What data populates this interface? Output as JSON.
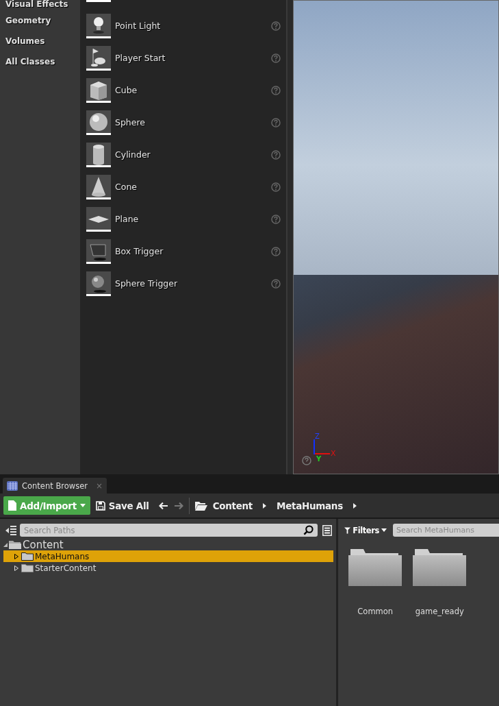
{
  "categories": [
    {
      "label": "Visual Effects"
    },
    {
      "label": "Geometry"
    },
    {
      "label": "Volumes"
    },
    {
      "label": "All Classes"
    }
  ],
  "actors": [
    {
      "label": "Point Light",
      "kind": "bulb"
    },
    {
      "label": "Player Start",
      "kind": "flag"
    },
    {
      "label": "Cube",
      "kind": "cube"
    },
    {
      "label": "Sphere",
      "kind": "sphere"
    },
    {
      "label": "Cylinder",
      "kind": "cylinder"
    },
    {
      "label": "Cone",
      "kind": "cone"
    },
    {
      "label": "Plane",
      "kind": "plane"
    },
    {
      "label": "Box Trigger",
      "kind": "boxtrigger"
    },
    {
      "label": "Sphere Trigger",
      "kind": "spheretrigger"
    }
  ],
  "viewport": {
    "axes": [
      "Z",
      "Y",
      "X"
    ]
  },
  "content_browser": {
    "tab": {
      "title": "Content Browser",
      "close": "×"
    },
    "toolbar": {
      "add_button": "Add/Import",
      "save_button": "Save All",
      "breadcrumbs": [
        "Content",
        "MetaHumans"
      ]
    },
    "paths": {
      "placeholder": "Search Paths",
      "tree": [
        {
          "label": "Content",
          "expanded": true,
          "children": [
            {
              "label": "MetaHumans",
              "selected": true,
              "expanded": false
            },
            {
              "label": "StarterContent",
              "selected": false,
              "expanded": false
            }
          ]
        }
      ]
    },
    "assets": {
      "filters": "Filters",
      "placeholder": "Search MetaHumans",
      "folders": [
        "Common",
        "game_ready"
      ]
    }
  }
}
